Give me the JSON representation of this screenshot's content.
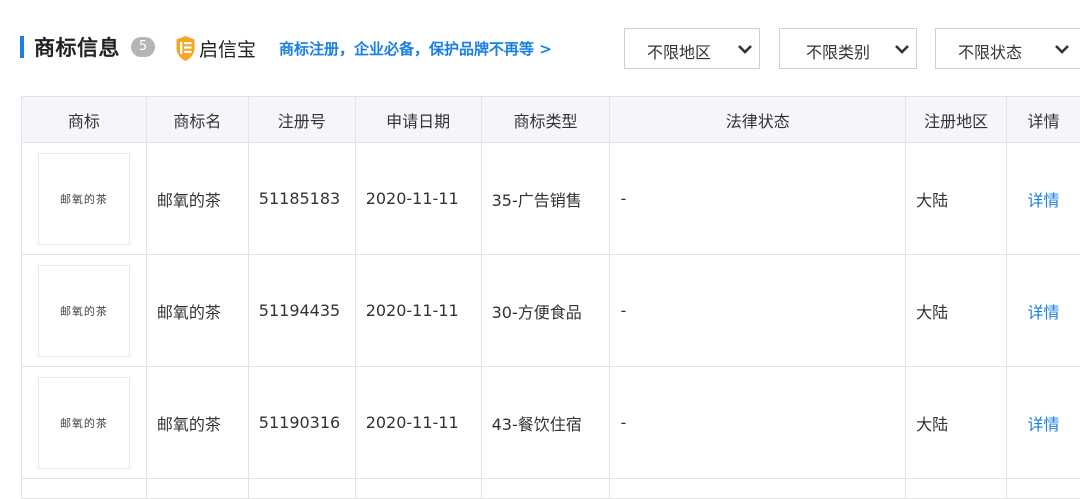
{
  "header": {
    "title": "商标信息",
    "count": "5",
    "brand_name": "启信宝",
    "brand_icon": "qixinbao-shield-icon",
    "brand_icon_color": "#f5a623",
    "accent_color": "#1a7fe0",
    "promo_link": "商标注册，企业必备，保护品牌不再等 >"
  },
  "filters": {
    "region": "不限地区",
    "class": "不限类别",
    "status": "不限状态"
  },
  "table": {
    "columns": [
      "商标",
      "商标名",
      "注册号",
      "申请日期",
      "商标类型",
      "法律状态",
      "注册地区",
      "详情"
    ],
    "rows": [
      {
        "logo_text": "邮氧的茶",
        "name": "邮氧的茶",
        "reg_no": "51185183",
        "date": "2020-11-11",
        "type": "35-广告销售",
        "status": "-",
        "region": "大陆",
        "detail": "详情"
      },
      {
        "logo_text": "邮氧的茶",
        "name": "邮氧的茶",
        "reg_no": "51194435",
        "date": "2020-11-11",
        "type": "30-方便食品",
        "status": "-",
        "region": "大陆",
        "detail": "详情"
      },
      {
        "logo_text": "邮氧的茶",
        "name": "邮氧的茶",
        "reg_no": "51190316",
        "date": "2020-11-11",
        "type": "43-餐饮住宿",
        "status": "-",
        "region": "大陆",
        "detail": "详情"
      }
    ]
  }
}
